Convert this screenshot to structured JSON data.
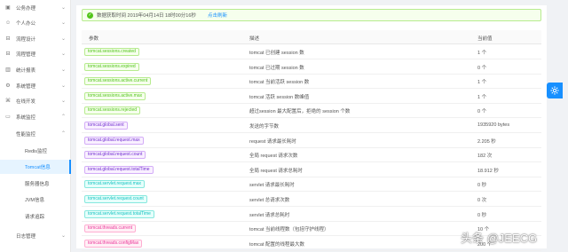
{
  "sidebar": {
    "items": [
      {
        "label": "公务办理",
        "icon": "briefcase-icon"
      },
      {
        "label": "个人办公",
        "icon": "user-icon"
      },
      {
        "label": "流程设计",
        "icon": "flow-icon"
      },
      {
        "label": "流程管理",
        "icon": "flow-icon"
      },
      {
        "label": "统计报表",
        "icon": "chart-icon"
      },
      {
        "label": "系统管理",
        "icon": "settings-icon"
      },
      {
        "label": "在线开发",
        "icon": "code-icon"
      },
      {
        "label": "系统监控",
        "icon": "monitor-icon"
      }
    ],
    "group": {
      "label": "性能监控"
    },
    "subitems": [
      {
        "label": "Redis监控"
      },
      {
        "label": "Tomcat信息",
        "active": true
      },
      {
        "label": "服务器信息"
      },
      {
        "label": "JVM信息"
      },
      {
        "label": "请求追踪"
      }
    ],
    "bottom": {
      "label": "日志管理"
    }
  },
  "alert": {
    "text": "数据获取时间 2019年04月14日 18时00分16秒",
    "refresh_label": "点击刷新"
  },
  "table": {
    "headers": [
      "参数",
      "描述",
      "当前值"
    ],
    "rows": [
      {
        "param": "tomcat.sessions.created",
        "color": "green",
        "desc": "tomcat 已创建 session 数",
        "value": "1 个"
      },
      {
        "param": "tomcat.sessions.expired",
        "color": "green",
        "desc": "tomcat 已过期 session 数",
        "value": "0 个"
      },
      {
        "param": "tomcat.sessions.active.current",
        "color": "green",
        "desc": "tomcat 当前活跃 session 数",
        "value": "1 个"
      },
      {
        "param": "tomcat.sessions.active.max",
        "color": "green",
        "desc": "tomcat 活跃 session 数峰值",
        "value": "1 个"
      },
      {
        "param": "tomcat.sessions.rejected",
        "color": "green",
        "desc": "超过session 最大配置后，拒绝的 session 个数",
        "value": "0 个"
      },
      {
        "param": "tomcat.global.sent",
        "color": "purple",
        "desc": "发送的字节数",
        "value": "1935920 bytes"
      },
      {
        "param": "tomcat.global.request.max",
        "color": "purple",
        "desc": "request 请求最长耗时",
        "value": "2.205 秒"
      },
      {
        "param": "tomcat.global.request.count",
        "color": "purple",
        "desc": "全局 request 请求次数",
        "value": "182 次"
      },
      {
        "param": "tomcat.global.request.totalTime",
        "color": "purple",
        "desc": "全局 request 请求总耗时",
        "value": "18.912 秒"
      },
      {
        "param": "tomcat.servlet.request.max",
        "color": "cyan",
        "desc": "servlet 请求最长耗时",
        "value": "0 秒"
      },
      {
        "param": "tomcat.servlet.request.count",
        "color": "cyan",
        "desc": "servlet 总请求次数",
        "value": "0 次"
      },
      {
        "param": "tomcat.servlet.request.totalTime",
        "color": "cyan",
        "desc": "servlet 请求总耗时",
        "value": "0 秒"
      },
      {
        "param": "tomcat.threads.current",
        "color": "pink",
        "desc": "tomcat 当前线程数（包括守护线程）",
        "value": "10 个"
      },
      {
        "param": "tomcat.threads.configMax",
        "color": "pink",
        "desc": "tomcat 配置的线程最大数",
        "value": "200 个"
      }
    ]
  },
  "settings": {
    "icon": "gear-icon"
  },
  "watermark": {
    "text": "头条 @JEECG"
  },
  "colors": {
    "primary": "#1890ff",
    "success": "#52c41a",
    "purple": "#722ed1",
    "cyan": "#13c2c2",
    "pink": "#eb2f96"
  }
}
